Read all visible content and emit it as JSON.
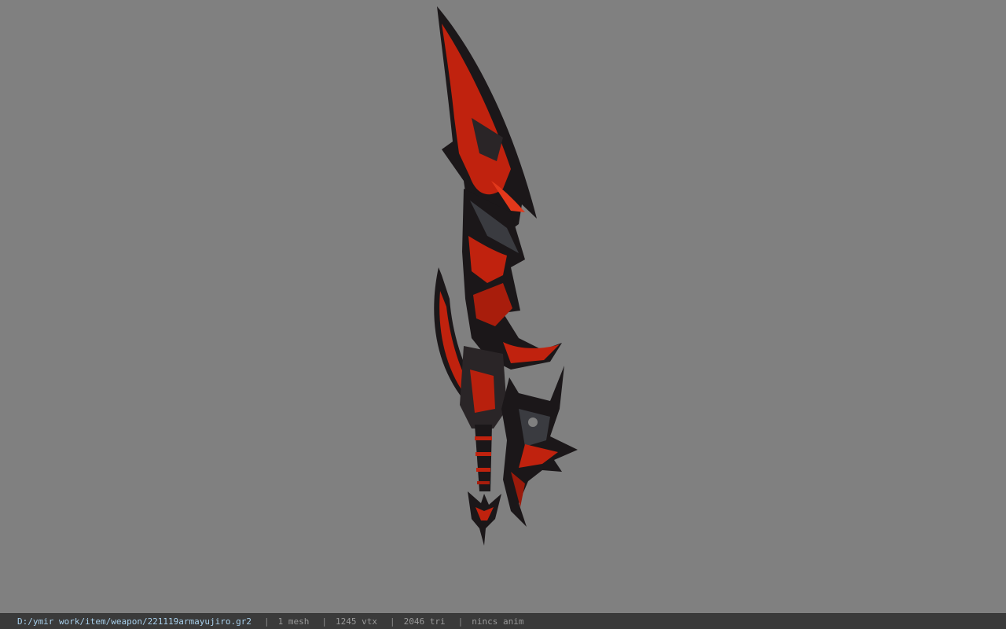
{
  "viewer": {
    "background_color": "#808080",
    "model_colors": {
      "dark": "#1b1719",
      "red": "#c0220e",
      "bright_red": "#e2381b",
      "steel": "#3a3b40"
    }
  },
  "statusbar": {
    "path": "D:/ymir work/item/weapon/221119armayujiro.gr2",
    "separator": "|",
    "mesh": "1 mesh",
    "vertices": "1245 vtx",
    "triangles": "2046 tri",
    "animation": "nincs anim"
  }
}
